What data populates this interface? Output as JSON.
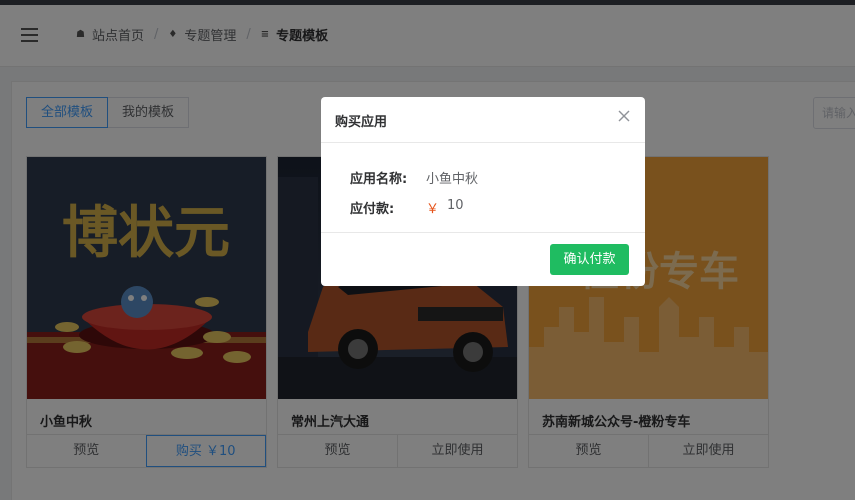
{
  "breadcrumb": [
    {
      "label": "站点首页",
      "icon": "home-icon"
    },
    {
      "label": "专题管理",
      "icon": "layers-icon"
    },
    {
      "label": "专题模板",
      "icon": "list-icon"
    }
  ],
  "tabs": [
    {
      "label": "全部模板",
      "active": true
    },
    {
      "label": "我的模板",
      "active": false
    }
  ],
  "search": {
    "placeholder": "请输入"
  },
  "cards": [
    {
      "name": "小鱼中秋",
      "thumb_text": "博状元",
      "action1": "预览",
      "action2": "购买 ￥10"
    },
    {
      "name": "常州上汽大通",
      "action1": "预览",
      "action2": "立即使用"
    },
    {
      "name": "苏南新城公众号-橙粉专车",
      "thumb_text": "橙粉专车",
      "action1": "预览",
      "action2": "立即使用"
    }
  ],
  "dialog": {
    "title": "购买应用",
    "app_name_label": "应用名称:",
    "app_name": "小鱼中秋",
    "payment_label": "应付款:",
    "currency": "￥",
    "amount": "10",
    "confirm_label": "确认付款"
  },
  "colors": {
    "accent": "#409eff",
    "confirm": "#1fbc61",
    "price": "#e6531a"
  }
}
